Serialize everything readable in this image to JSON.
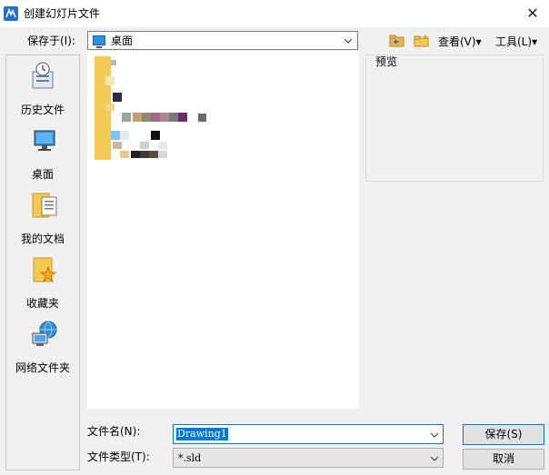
{
  "window": {
    "title": "创建幻灯片文件",
    "close": "✕"
  },
  "toolbar": {
    "save_in_label": "保存于(I):",
    "location": "桌面",
    "view_menu": "查看(V)",
    "tools_menu": "工具(L)",
    "dropdown_arrow": "▾"
  },
  "places": [
    {
      "label": "历史文件",
      "icon": "history-icon"
    },
    {
      "label": "桌面",
      "icon": "desktop-icon"
    },
    {
      "label": "我的文档",
      "icon": "documents-icon"
    },
    {
      "label": "收藏夹",
      "icon": "favorites-icon"
    },
    {
      "label": "网络文件夹",
      "icon": "network-icon"
    }
  ],
  "preview": {
    "label": "预览"
  },
  "form": {
    "filename_label": "文件名(N):",
    "filename_value": "Drawing1",
    "filetype_label": "文件类型(T):",
    "filetype_value": "*.sld"
  },
  "buttons": {
    "save": "保存(S)",
    "cancel": "取消"
  },
  "colors": {
    "selection": "#0078d7",
    "folder": "#f3c94f",
    "accent": "#1e6fd9"
  }
}
